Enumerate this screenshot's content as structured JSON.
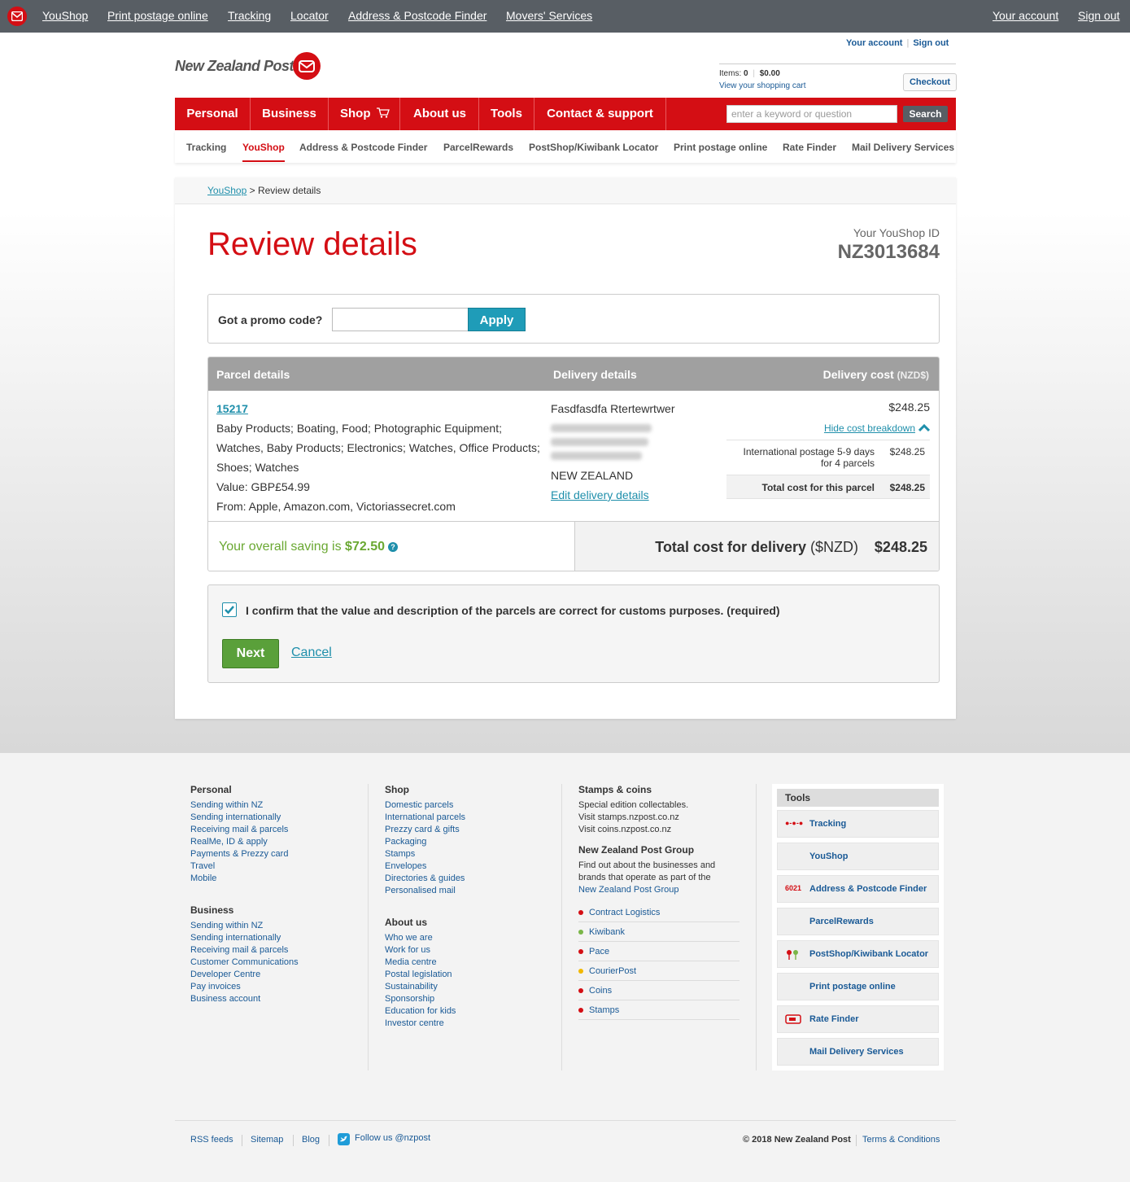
{
  "topbar": {
    "links": [
      "YouShop",
      "Print postage online",
      "Tracking",
      "Locator",
      "Address & Postcode Finder",
      "Movers' Services"
    ],
    "your_account": "Your account",
    "sign_out": "Sign out"
  },
  "header": {
    "account_link": "Your account",
    "signout_link": "Sign out",
    "logo_text": "New Zealand Post",
    "cart_items_label": "Items:",
    "cart_items_count": "0",
    "cart_total": "$0.00",
    "cart_view": "View your shopping cart",
    "checkout": "Checkout"
  },
  "mainnav": {
    "items": [
      "Personal",
      "Business",
      "Shop",
      "About us",
      "Tools",
      "Contact & support"
    ],
    "search_placeholder": "enter a keyword or question",
    "search_button": "Search"
  },
  "subnav": {
    "items": [
      "Tracking",
      "YouShop",
      "Address & Postcode Finder",
      "ParcelRewards",
      "PostShop/Kiwibank Locator",
      "Print postage online",
      "Rate Finder",
      "Mail Delivery Services"
    ]
  },
  "breadcrumb": {
    "root": "YouShop",
    "sep": " > ",
    "current": "Review details"
  },
  "page": {
    "title": "Review details",
    "youshop_id_label": "Your YouShop ID",
    "youshop_id": "NZ3013684"
  },
  "promo": {
    "label": "Got a promo code?",
    "value": "",
    "apply": "Apply"
  },
  "table": {
    "col_parcel": "Parcel details",
    "col_delivery": "Delivery details",
    "col_cost": "Delivery cost",
    "col_cost_unit": "(NZD$)",
    "parcel": {
      "id": "15217",
      "desc_lines": [
        "Baby Products; Boating, Food; Photographic Equipment;",
        "Watches, Baby Products; Electronics; Watches, Office Products;",
        "Shoes; Watches"
      ],
      "value": "Value: GBP£54.99",
      "from": "From: Apple, Amazon.com, Victoriassecret.com"
    },
    "delivery": {
      "name": "Fasdfasdfa Rtertewrtwer",
      "country": "NEW ZEALAND",
      "edit": "Edit delivery details"
    },
    "cost": {
      "amount": "$248.25",
      "hide_breakdown": "Hide cost breakdown",
      "line1": "International postage 5-9 days",
      "line2": "for 4 parcels",
      "line_amount": "$248.25",
      "total_label": "Total cost for this parcel",
      "total_amount": "$248.25"
    },
    "saving_text": "Your overall saving is ",
    "saving_amount": "$72.50",
    "total_label": "Total cost for delivery ",
    "total_unit": "($NZD)",
    "total_value": "$248.25"
  },
  "confirm": {
    "text": "I confirm that the value and description of the parcels are correct for customs purposes. (required)",
    "next": "Next",
    "cancel": "Cancel"
  },
  "footer": {
    "personal": {
      "title": "Personal",
      "links": [
        "Sending within NZ",
        "Sending internationally",
        "Receiving mail & parcels",
        "RealMe, ID & apply",
        "Payments & Prezzy card",
        "Travel",
        "Mobile"
      ]
    },
    "business": {
      "title": "Business",
      "links": [
        "Sending within NZ",
        "Sending internationally",
        "Receiving mail & parcels",
        "Customer Communications",
        "Developer Centre",
        "Pay invoices",
        "Business account"
      ]
    },
    "shop": {
      "title": "Shop",
      "links": [
        "Domestic parcels",
        "International parcels",
        "Prezzy card & gifts",
        "Packaging",
        "Stamps",
        "Envelopes",
        "Directories & guides",
        "Personalised mail"
      ]
    },
    "about": {
      "title": "About us",
      "links": [
        "Who we are",
        "Work for us",
        "Media centre",
        "Postal legislation",
        "Sustainability",
        "Sponsorship",
        "Education for kids",
        "Investor centre"
      ]
    },
    "stamps": {
      "title": "Stamps & coins",
      "lines": [
        "Special edition collectables.",
        "Visit stamps.nzpost.co.nz",
        "Visit coins.nzpost.co.nz"
      ]
    },
    "group": {
      "title": "New Zealand Post Group",
      "lines": [
        "Find out about the businesses and",
        "brands that operate as part of the"
      ],
      "link": "New Zealand Post Group",
      "items": [
        {
          "label": "Contract Logistics",
          "color": "#d40e14"
        },
        {
          "label": "Kiwibank",
          "color": "#7ab648"
        },
        {
          "label": "Pace",
          "color": "#d40e14"
        },
        {
          "label": "CourierPost",
          "color": "#f2b800"
        },
        {
          "label": "Coins",
          "color": "#d40e14"
        },
        {
          "label": "Stamps",
          "color": "#d40e14"
        }
      ]
    },
    "tools": {
      "title": "Tools",
      "items": [
        {
          "label": "Tracking",
          "icon": "tracking-icon",
          "glyph": "●-●-●"
        },
        {
          "label": "YouShop",
          "icon": "",
          "glyph": ""
        },
        {
          "label": "Address & Postcode Finder",
          "icon": "postcode-icon",
          "glyph": "6021"
        },
        {
          "label": "ParcelRewards",
          "icon": "",
          "glyph": ""
        },
        {
          "label": "PostShop/Kiwibank Locator",
          "icon": "locator-pin-icon",
          "glyph": "📍"
        },
        {
          "label": "Print postage online",
          "icon": "",
          "glyph": ""
        },
        {
          "label": "Rate Finder",
          "icon": "rate-finder-icon",
          "glyph": "▭"
        },
        {
          "label": "Mail Delivery Services",
          "icon": "",
          "glyph": ""
        }
      ]
    },
    "bottom": {
      "rss": "RSS feeds",
      "sitemap": "Sitemap",
      "blog": "Blog",
      "follow": "Follow us @nzpost",
      "copyright": "© 2018 New Zealand Post",
      "terms": "Terms & Conditions"
    }
  }
}
